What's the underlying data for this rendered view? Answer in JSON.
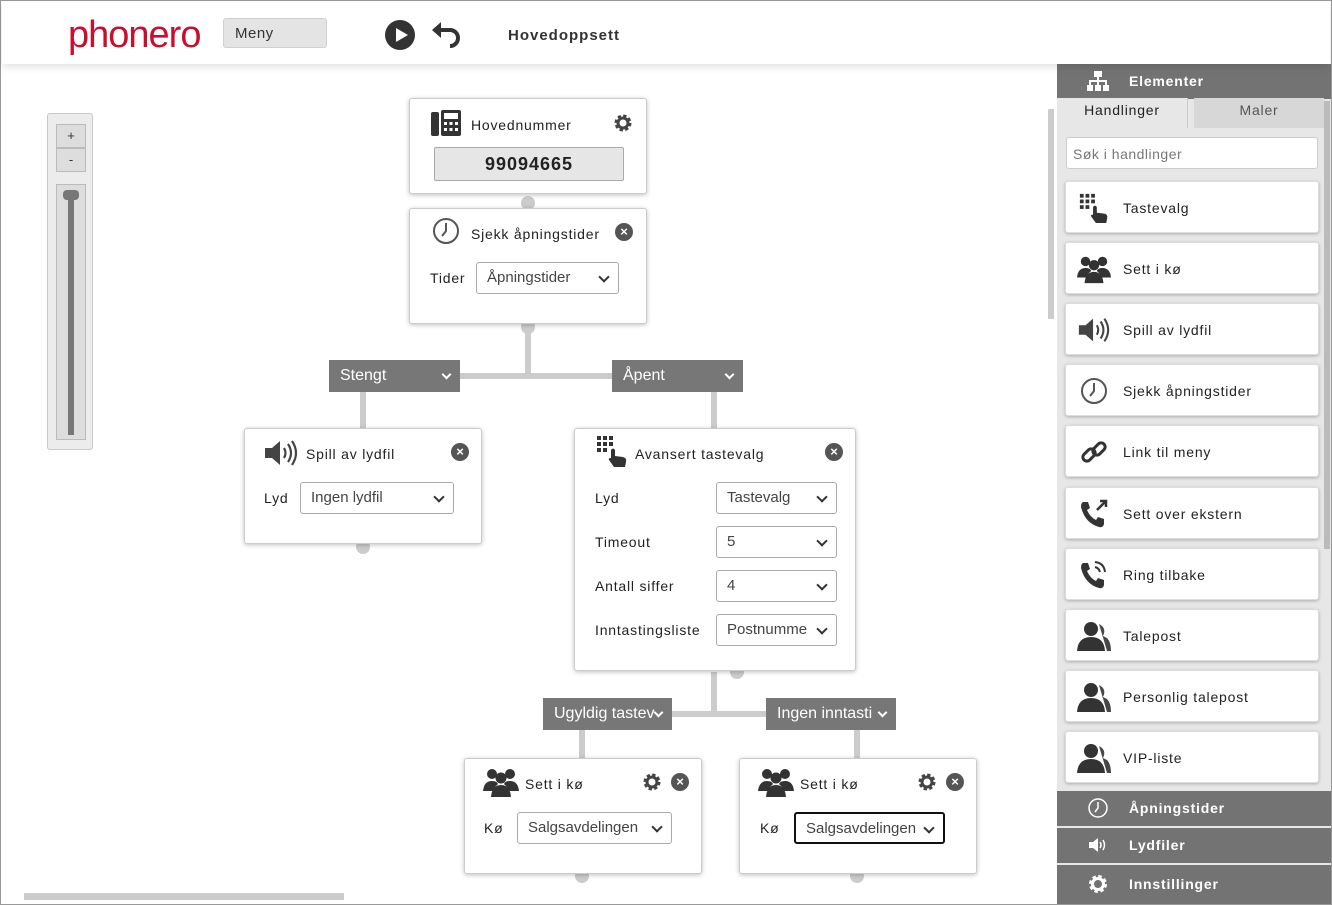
{
  "app": {
    "logo": "phonero",
    "menu_label": "Meny",
    "page_title": "Hovedoppsett"
  },
  "zoom": {
    "plus": "+",
    "minus": "-",
    "level": 1.0
  },
  "nodes": {
    "main_number": {
      "title": "Hovednummer",
      "number": "99094665"
    },
    "opening_hours": {
      "title": "Sjekk åpningstider",
      "label": "Tider",
      "value": "Åpningstider"
    },
    "play_file": {
      "title": "Spill av lydfil",
      "label": "Lyd",
      "value": "Ingen lydfil"
    },
    "advanced_menu": {
      "title": "Avansert tastevalg",
      "fields": [
        {
          "label": "Lyd",
          "value": "Tastevalg"
        },
        {
          "label": "Timeout",
          "value": "5"
        },
        {
          "label": "Antall siffer",
          "value": "4"
        },
        {
          "label": "Inntastingsliste",
          "value": "Postnumme"
        }
      ]
    },
    "queue_left": {
      "title": "Sett i kø",
      "label": "Kø",
      "value": "Salgsavdelingen"
    },
    "queue_right": {
      "title": "Sett i kø",
      "label": "Kø",
      "value": "Salgsavdelingen"
    }
  },
  "branches": {
    "closed": "Stengt",
    "open": "Åpent",
    "invalid": "Ugyldig tastev",
    "no_input": "Ingen inntasti"
  },
  "sidebar": {
    "header": "Elementer",
    "tabs": [
      "Handlinger",
      "Maler"
    ],
    "search_placeholder": "Søk i handlinger",
    "items": [
      "Tastevalg",
      "Sett i kø",
      "Spill av lydfil",
      "Sjekk åpningstider",
      "Link til meny",
      "Sett over ekstern",
      "Ring tilbake",
      "Talepost",
      "Personlig talepost",
      "VIP-liste"
    ],
    "footer": [
      "Åpningstider",
      "Lydfiler",
      "Innstillinger"
    ]
  }
}
